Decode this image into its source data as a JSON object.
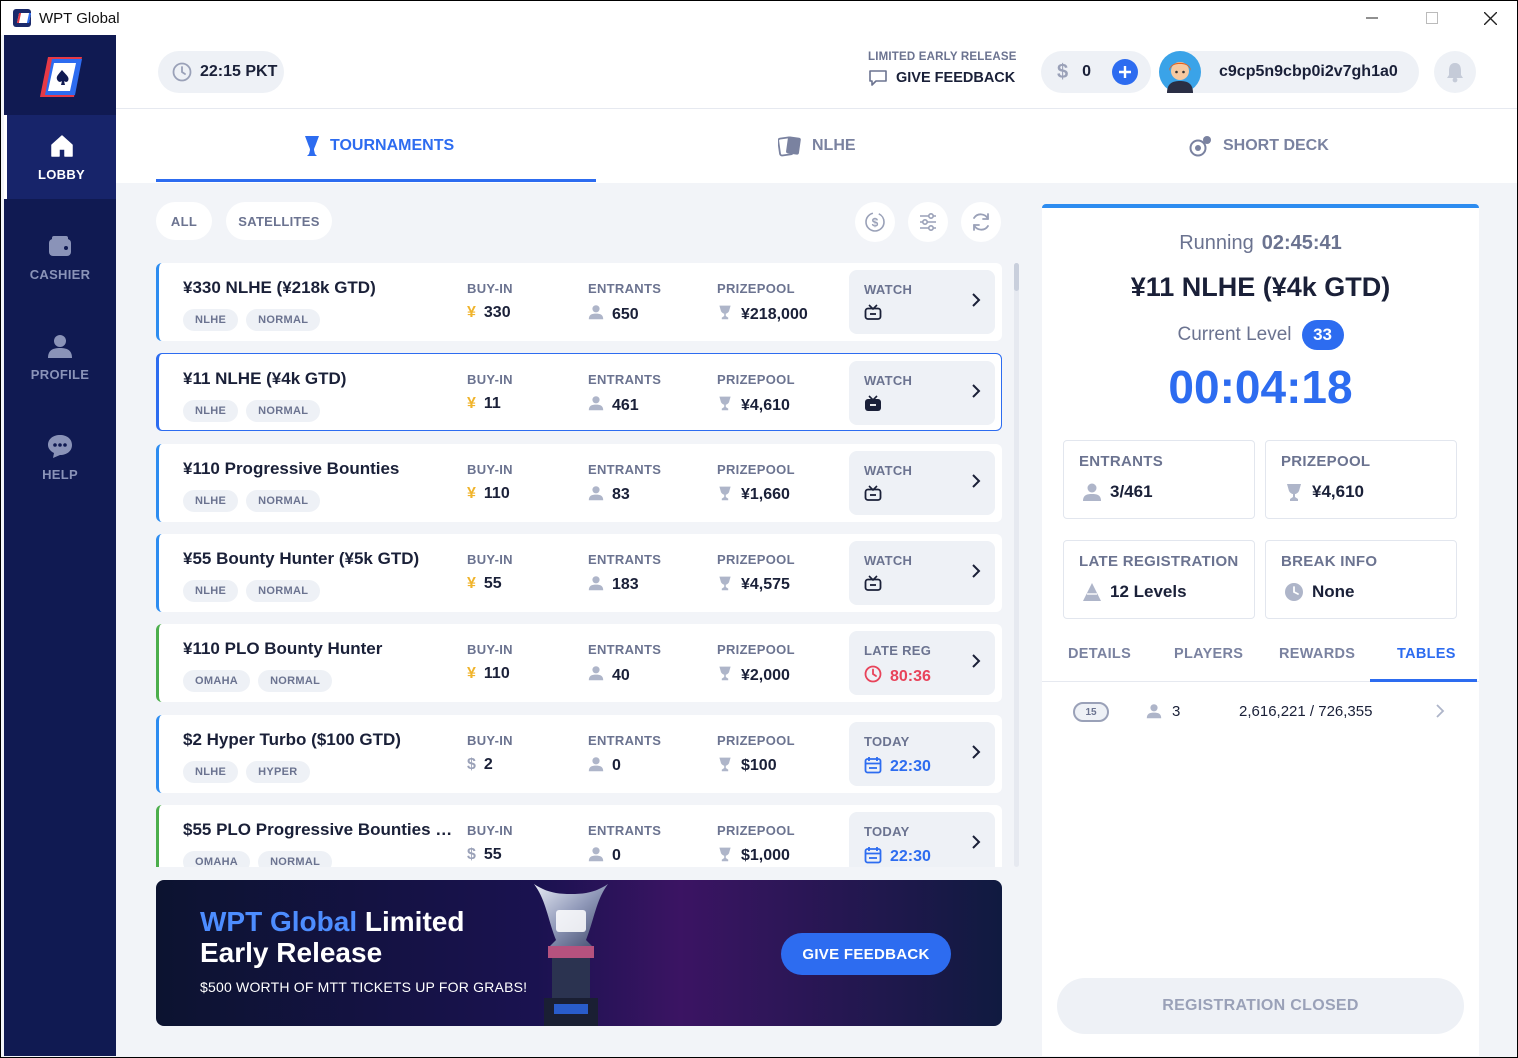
{
  "window": {
    "title": "WPT Global"
  },
  "sidebar": {
    "items": [
      {
        "label": "LOBBY",
        "icon": "home-icon",
        "active": true
      },
      {
        "label": "CASHIER",
        "icon": "wallet-icon",
        "active": false
      },
      {
        "label": "PROFILE",
        "icon": "user-icon",
        "active": false
      },
      {
        "label": "HELP",
        "icon": "chat-icon",
        "active": false
      }
    ]
  },
  "header": {
    "time": "22:15 PKT",
    "feedback_small": "LIMITED EARLY RELEASE",
    "feedback_label": "GIVE FEEDBACK",
    "balance": "0",
    "currency_symbol": "$",
    "username": "c9cp5n9cbp0i2v7gh1a0"
  },
  "tabs": [
    {
      "label": "TOURNAMENTS",
      "icon": "trophy-icon",
      "active": true
    },
    {
      "label": "NLHE",
      "icon": "cards-icon",
      "active": false
    },
    {
      "label": "SHORT DECK",
      "icon": "chip-icon",
      "active": false
    }
  ],
  "filters": {
    "all": "ALL",
    "satellites": "SATELLITES"
  },
  "columns": {
    "buyin": "BUY-IN",
    "entrants": "ENTRANTS",
    "prizepool": "PRIZEPOOL"
  },
  "tournaments": [
    {
      "name": "¥330 NLHE (¥218k GTD)",
      "tags": [
        "NLHE",
        "NORMAL"
      ],
      "currency": "¥",
      "buyin": "330",
      "entrants": "650",
      "prizepool": "¥218,000",
      "action_label": "WATCH",
      "action_value": "",
      "action_icon": "tv-icon",
      "game": "nlhe"
    },
    {
      "name": "¥11 NLHE (¥4k GTD)",
      "tags": [
        "NLHE",
        "NORMAL"
      ],
      "currency": "¥",
      "buyin": "11",
      "entrants": "461",
      "prizepool": "¥4,610",
      "action_label": "WATCH",
      "action_value": "",
      "action_icon": "tv-filled-icon",
      "game": "nlhe",
      "selected": true
    },
    {
      "name": "¥110 Progressive Bounties",
      "tags": [
        "NLHE",
        "NORMAL"
      ],
      "currency": "¥",
      "buyin": "110",
      "entrants": "83",
      "prizepool": "¥1,660",
      "action_label": "WATCH",
      "action_value": "",
      "action_icon": "tv-icon",
      "game": "nlhe"
    },
    {
      "name": "¥55 Bounty Hunter (¥5k GTD)",
      "tags": [
        "NLHE",
        "NORMAL"
      ],
      "currency": "¥",
      "buyin": "55",
      "entrants": "183",
      "prizepool": "¥4,575",
      "action_label": "WATCH",
      "action_value": "",
      "action_icon": "tv-icon",
      "game": "nlhe"
    },
    {
      "name": "¥110 PLO Bounty Hunter",
      "tags": [
        "OMAHA",
        "NORMAL"
      ],
      "currency": "¥",
      "buyin": "110",
      "entrants": "40",
      "prizepool": "¥2,000",
      "action_label": "LATE REG",
      "action_value": "80:36",
      "action_icon": "clock-icon",
      "game": "omaha",
      "action_color": "#e8435a"
    },
    {
      "name": "$2 Hyper Turbo ($100 GTD)",
      "tags": [
        "NLHE",
        "HYPER"
      ],
      "currency": "$",
      "buyin": "2",
      "entrants": "0",
      "prizepool": "$100",
      "action_label": "TODAY",
      "action_value": "22:30",
      "action_icon": "calendar-icon",
      "game": "nlhe",
      "action_color": "#2d6cf0"
    },
    {
      "name": "$55 PLO Progressive Bounties (...",
      "tags": [
        "OMAHA",
        "NORMAL"
      ],
      "currency": "$",
      "buyin": "55",
      "entrants": "0",
      "prizepool": "$1,000",
      "action_label": "TODAY",
      "action_value": "22:30",
      "action_icon": "calendar-icon",
      "game": "omaha",
      "action_color": "#2d6cf0"
    }
  ],
  "banner": {
    "brand": "WPT Global",
    "line1_rest": " Limited",
    "line2": "Early Release",
    "subtitle": "$500 WORTH OF MTT TICKETS UP FOR GRABS!",
    "button": "GIVE FEEDBACK"
  },
  "detail": {
    "status": "Running",
    "elapsed": "02:45:41",
    "title": "¥11 NLHE (¥4k GTD)",
    "current_level_label": "Current Level",
    "current_level": "33",
    "timer": "00:04:18",
    "entrants_label": "ENTRANTS",
    "entrants": "3/461",
    "prizepool_label": "PRIZEPOOL",
    "prizepool": "¥4,610",
    "late_reg_label": "LATE REGISTRATION",
    "late_reg": "12 Levels",
    "break_label": "BREAK INFO",
    "break": "None",
    "tabs": [
      "DETAILS",
      "PLAYERS",
      "REWARDS",
      "TABLES"
    ],
    "active_tab": "TABLES",
    "table_row": {
      "table_no": "15",
      "players": "3",
      "chips": "2,616,221 / 726,355"
    },
    "register_button": "REGISTRATION CLOSED"
  }
}
